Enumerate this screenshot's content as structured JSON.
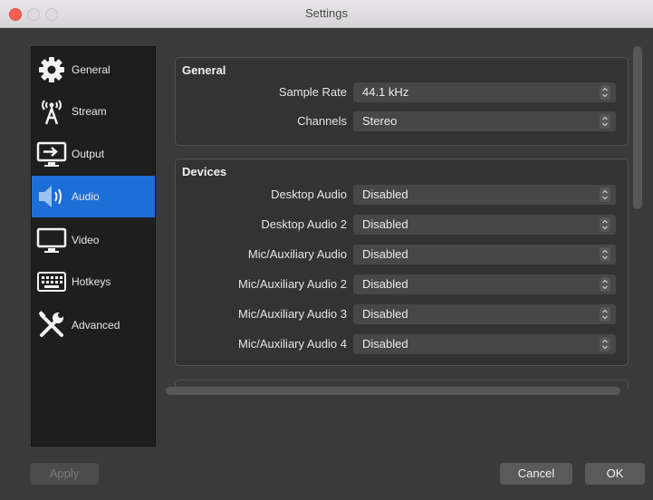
{
  "window": {
    "title": "Settings"
  },
  "sidebar": {
    "items": [
      {
        "label": "General",
        "icon": "gear-icon",
        "active": false
      },
      {
        "label": "Stream",
        "icon": "antenna-icon",
        "active": false
      },
      {
        "label": "Output",
        "icon": "output-icon",
        "active": false
      },
      {
        "label": "Audio",
        "icon": "speaker-icon",
        "active": true
      },
      {
        "label": "Video",
        "icon": "monitor-icon",
        "active": false
      },
      {
        "label": "Hotkeys",
        "icon": "keyboard-icon",
        "active": false
      },
      {
        "label": "Advanced",
        "icon": "tools-icon",
        "active": false
      }
    ]
  },
  "general_group": {
    "title": "General",
    "rows": [
      {
        "label": "Sample Rate",
        "value": "44.1 kHz"
      },
      {
        "label": "Channels",
        "value": "Stereo"
      }
    ]
  },
  "devices_group": {
    "title": "Devices",
    "rows": [
      {
        "label": "Desktop Audio",
        "value": "Disabled"
      },
      {
        "label": "Desktop Audio 2",
        "value": "Disabled"
      },
      {
        "label": "Mic/Auxiliary Audio",
        "value": "Disabled"
      },
      {
        "label": "Mic/Auxiliary Audio 2",
        "value": "Disabled"
      },
      {
        "label": "Mic/Auxiliary Audio 3",
        "value": "Disabled"
      },
      {
        "label": "Mic/Auxiliary Audio 4",
        "value": "Disabled"
      }
    ]
  },
  "buttons": {
    "apply": "Apply",
    "cancel": "Cancel",
    "ok": "OK"
  },
  "colors": {
    "accent": "#1c6fd6",
    "close": "#fc5f57"
  }
}
